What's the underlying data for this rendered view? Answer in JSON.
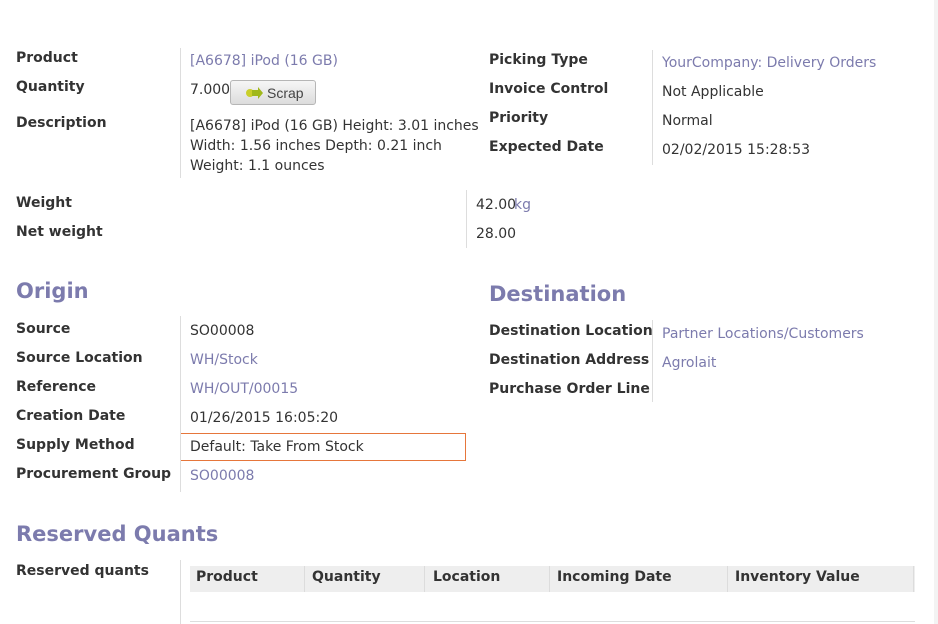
{
  "product": {
    "product_label": "Product",
    "product_value": "[A6678] iPod (16 GB)",
    "quantity_label": "Quantity",
    "quantity_value": "7.000",
    "scrap_label": "Scrap",
    "description_label": "Description",
    "description_lines": [
      "[A6678] iPod (16 GB) Height: 3.01 inches",
      "Width: 1.56 inches Depth: 0.21 inch",
      "Weight: 1.1 ounces"
    ]
  },
  "picking": {
    "picking_type_label": "Picking Type",
    "picking_type_value": "YourCompany: Delivery Orders",
    "invoice_control_label": "Invoice Control",
    "invoice_control_value": "Not Applicable",
    "priority_label": "Priority",
    "priority_value": "Normal",
    "expected_date_label": "Expected Date",
    "expected_date_value": "02/02/2015 15:28:53"
  },
  "weights": {
    "weight_label": "Weight",
    "weight_value": "42.00",
    "weight_unit": "kg",
    "net_weight_label": "Net weight",
    "net_weight_value": "28.00"
  },
  "origin": {
    "title": "Origin",
    "source_label": "Source",
    "source_value": "SO00008",
    "source_location_label": "Source Location",
    "source_location_value": "WH/Stock",
    "reference_label": "Reference",
    "reference_value": "WH/OUT/00015",
    "creation_date_label": "Creation Date",
    "creation_date_value": "01/26/2015 16:05:20",
    "supply_method_label": "Supply Method",
    "supply_method_value": "Default: Take From Stock",
    "procurement_group_label": "Procurement Group",
    "procurement_group_value": "SO00008"
  },
  "destination": {
    "title": "Destination",
    "location_label": "Destination Location",
    "location_value": "Partner Locations/Customers",
    "address_label": "Destination Address",
    "address_value": "Agrolait",
    "po_line_label": "Purchase Order Line"
  },
  "reserved": {
    "title": "Reserved Quants",
    "label": "Reserved quants",
    "columns": [
      "Product",
      "Quantity",
      "Location",
      "Incoming Date",
      "Inventory Value"
    ]
  },
  "colors": {
    "link": "#7c7bad",
    "focus_border": "#e6763b"
  }
}
